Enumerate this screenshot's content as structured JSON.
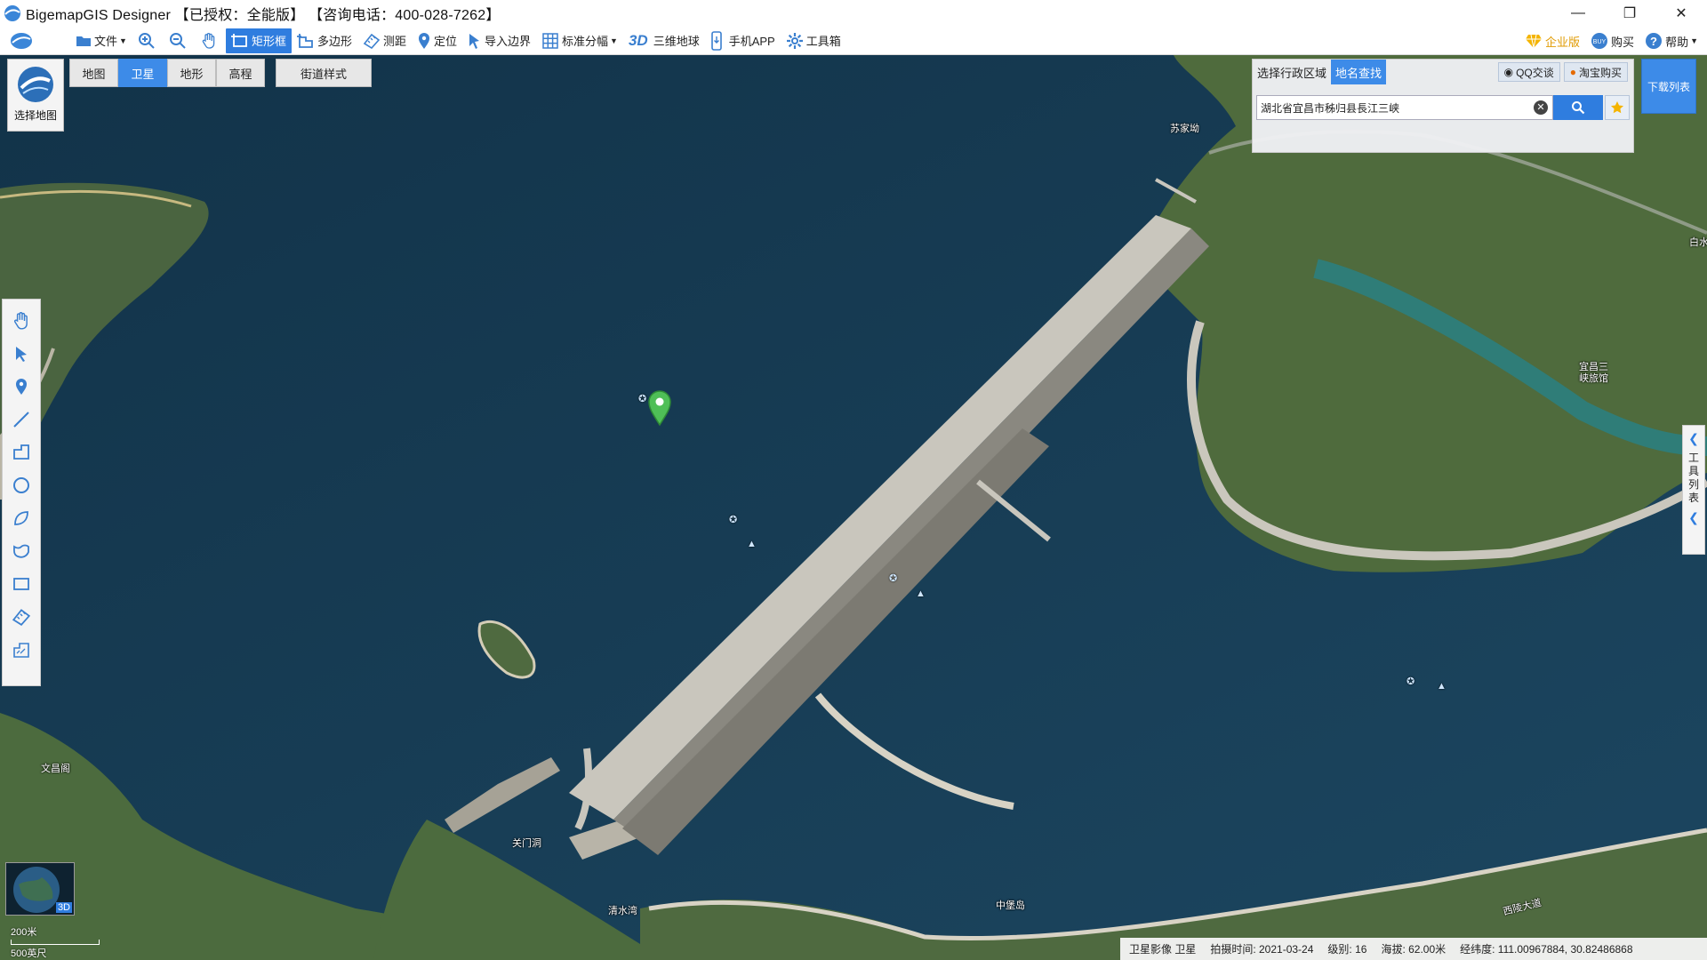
{
  "title_bar": {
    "title": "BigemapGIS Designer 【已授权：全能版】 【咨询电话：400-028-7262】",
    "window_controls": [
      "minimize",
      "restore",
      "close"
    ]
  },
  "toolbar": {
    "items": [
      {
        "name": "file",
        "label": "文件",
        "icon": "folder-icon"
      },
      {
        "name": "zoom-in",
        "label": "",
        "icon": "zoom-in-icon"
      },
      {
        "name": "zoom-out",
        "label": "",
        "icon": "zoom-out-icon"
      },
      {
        "name": "pan",
        "label": "",
        "icon": "hand-icon"
      },
      {
        "name": "rect-select",
        "label": "矩形框",
        "icon": "rect-select-icon",
        "active": true
      },
      {
        "name": "polygon",
        "label": "多边形",
        "icon": "polygon-icon"
      },
      {
        "name": "measure",
        "label": "测距",
        "icon": "ruler-icon"
      },
      {
        "name": "locate",
        "label": "定位",
        "icon": "pin-icon"
      },
      {
        "name": "import-boundary",
        "label": "导入边界",
        "icon": "cursor-icon"
      },
      {
        "name": "standard-sheet",
        "label": "标准分幅",
        "icon": "grid-icon"
      },
      {
        "name": "3d-globe",
        "label": "三维地球",
        "icon": "3d-icon"
      },
      {
        "name": "mobile-app",
        "label": "手机APP",
        "icon": "phone-icon"
      },
      {
        "name": "toolbox",
        "label": "工具箱",
        "icon": "gear-icon"
      }
    ],
    "right": {
      "enterprise": "企业版",
      "buy": "购买",
      "help": "帮助"
    }
  },
  "map_type": {
    "label": "选择地图",
    "layers": [
      "地图",
      "卫星",
      "地形",
      "高程"
    ],
    "active_layer": "卫星",
    "street_style": "街道样式"
  },
  "search": {
    "tabs": [
      "选择行政区域",
      "地名查找"
    ],
    "active_tab": "地名查找",
    "qq_chat": "QQ交谈",
    "taobao_buy": "淘宝购买",
    "input_value": "湖北省宜昌市秭归县長江三峡"
  },
  "download_list": "下载列表",
  "right_panel": {
    "label": "工具列表"
  },
  "map_labels": {
    "sudu": "苏家坳",
    "three_gorges": "宜昌三峡旅馆",
    "wenchangge": "文昌阁",
    "guanmendong": "关门洞",
    "qingshuiwan": "清水湾",
    "zhongbaodao": "中堡岛",
    "xiling_road": "西陵大道",
    "edge_text": "白水"
  },
  "minimap": {
    "tag": "3D"
  },
  "scale": {
    "metric": "200米",
    "imperial": "500英尺"
  },
  "status": {
    "source": "卫星影像 卫星",
    "capture_time": "拍摄时间: 2021-03-24",
    "level": "级别:  16",
    "altitude": "海拔: 62.00米",
    "coords": "经纬度:  111.00967884, 30.82486868"
  },
  "colors": {
    "accent": "#2f7ddf",
    "water": "#173a52",
    "land": "#4c6b3e",
    "dam": "#c9c6bd"
  }
}
